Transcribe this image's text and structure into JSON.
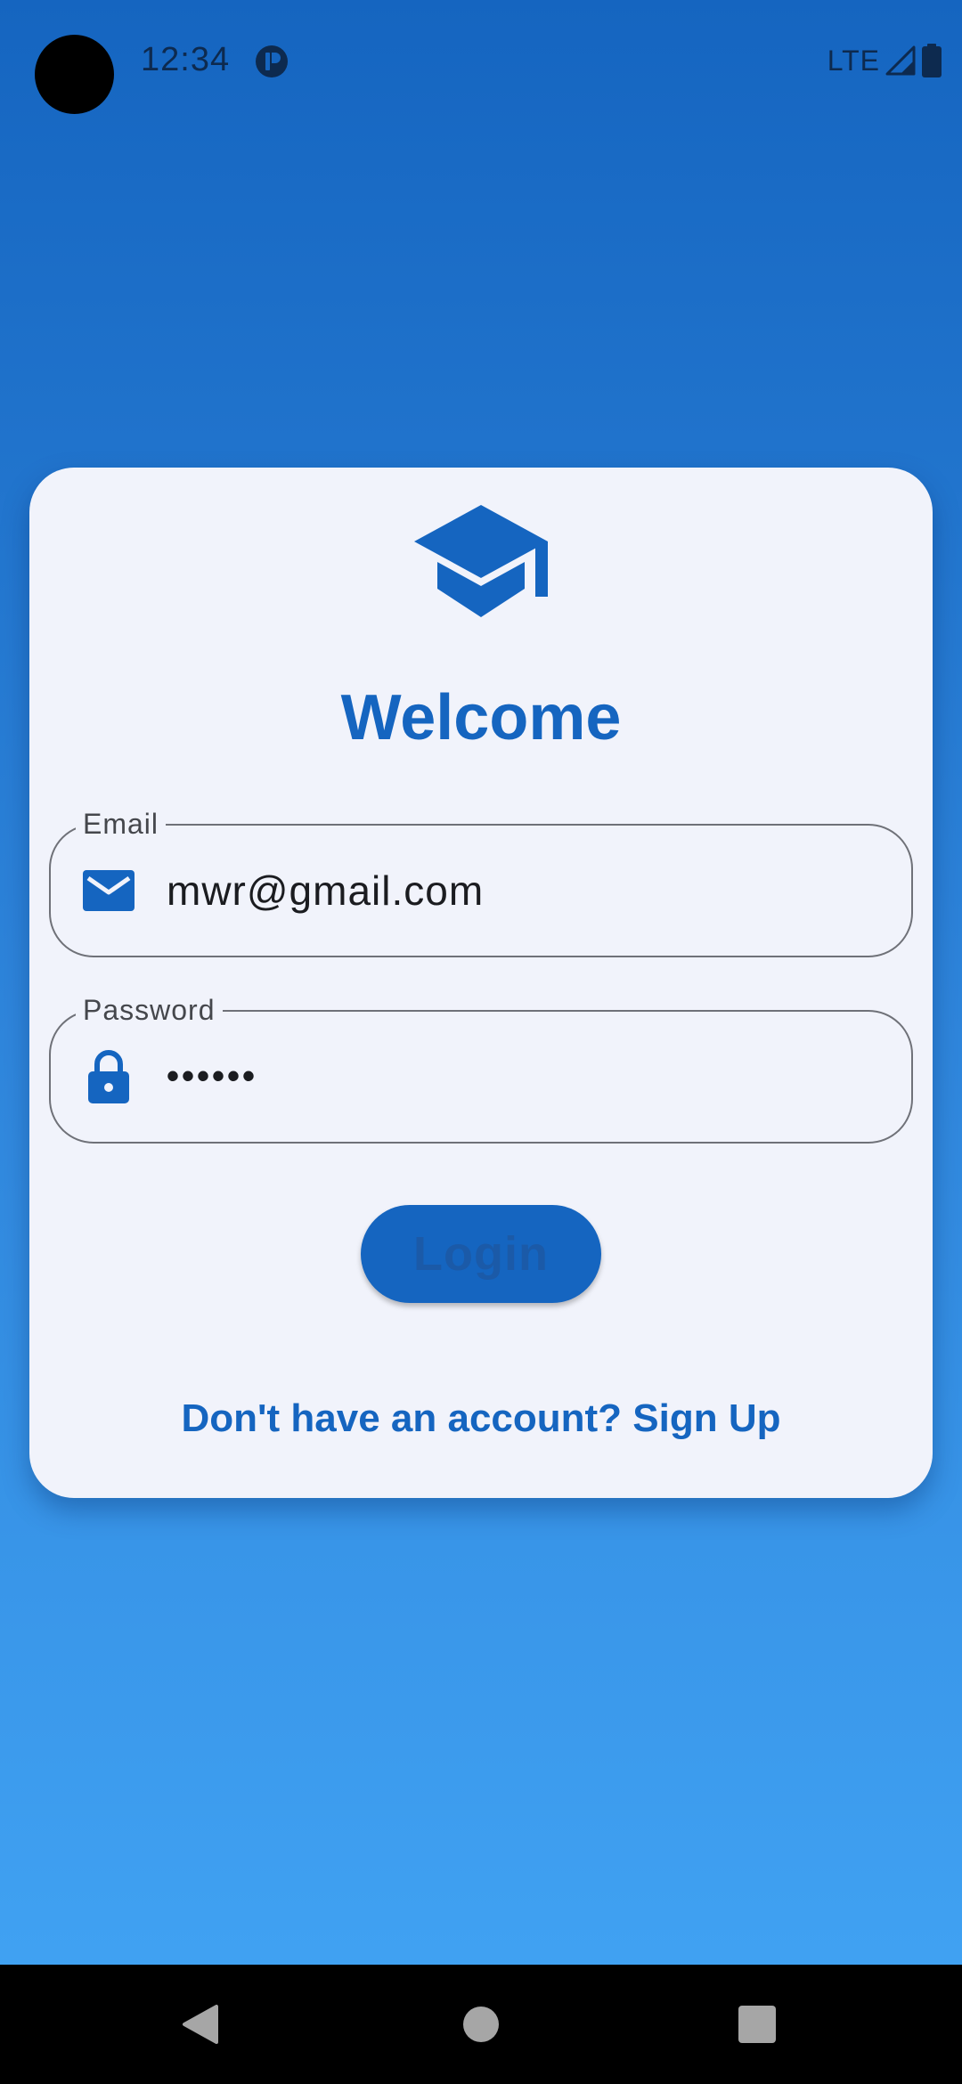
{
  "status_bar": {
    "time": "12:34",
    "network": "LTE",
    "icons": [
      "app-notification-icon",
      "signal-icon",
      "battery-icon"
    ]
  },
  "login": {
    "logo_icon": "graduation-cap-icon",
    "title": "Welcome",
    "email": {
      "label": "Email",
      "value": "mwr@gmail.com",
      "icon": "email-icon"
    },
    "password": {
      "label": "Password",
      "value": "••••••",
      "icon": "lock-icon"
    },
    "login_button_label": "Login",
    "signup_link": "Don't have an account? Sign Up"
  },
  "nav_bar": {
    "buttons": [
      "back-icon",
      "home-icon",
      "recents-icon"
    ]
  },
  "colors": {
    "accent": "#1565c0",
    "background_top": "#1565c0",
    "background_bottom": "#42a5f5",
    "card": "#f1f3fb",
    "field_border": "#6f7178"
  }
}
